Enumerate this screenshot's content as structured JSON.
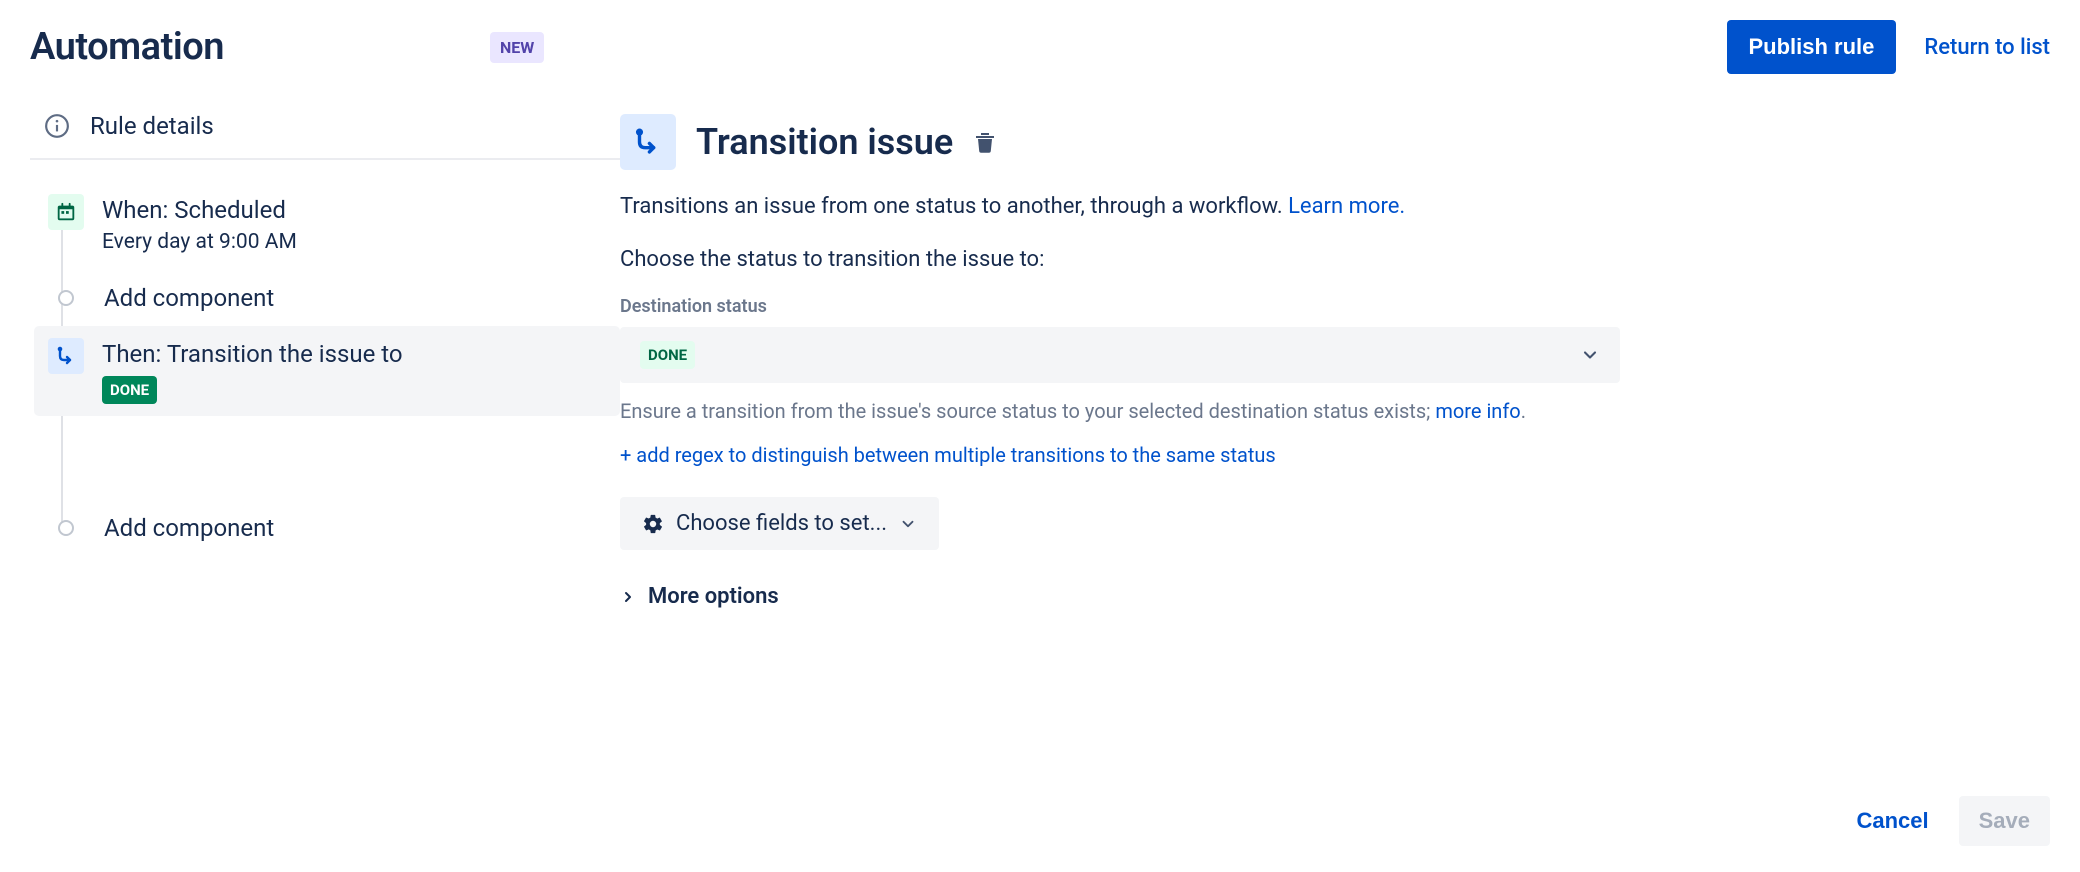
{
  "header": {
    "title": "Automation",
    "badge": "NEW",
    "publish_label": "Publish rule",
    "return_label": "Return to list"
  },
  "sidebar": {
    "rule_details": "Rule details",
    "when_title": "When: Scheduled",
    "when_sub": "Every day at 9:00 AM",
    "add_component": "Add component",
    "then_title": "Then: Transition the issue to",
    "then_badge": "DONE"
  },
  "panel": {
    "title": "Transition issue",
    "desc_text": "Transitions an issue from one status to another, through a workflow. ",
    "learn_more": "Learn more.",
    "choose_text": "Choose the status to transition the issue to:",
    "field_label": "Destination status",
    "status_value": "DONE",
    "helper_text": "Ensure a transition from the issue's source status to your selected destination status exists; ",
    "helper_link": "more info",
    "add_regex": "+ add regex to distinguish between multiple transitions to the same status",
    "choose_fields": "Choose fields to set...",
    "more_options": "More options"
  },
  "footer": {
    "cancel": "Cancel",
    "save": "Save"
  }
}
